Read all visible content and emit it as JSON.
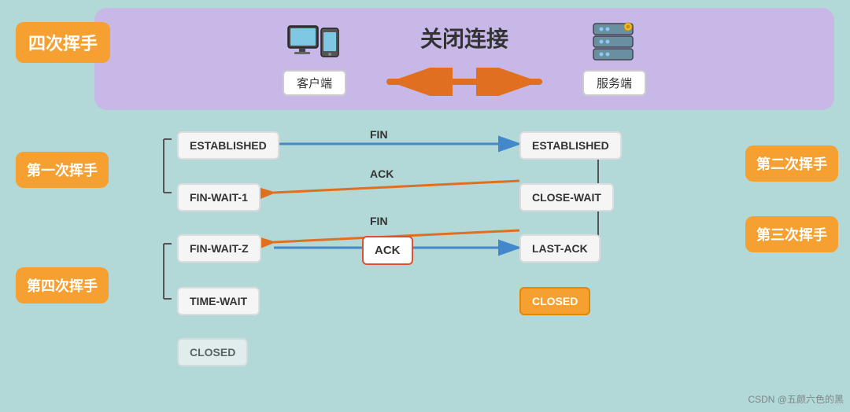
{
  "header": {
    "title": "关闭连接",
    "side_label": "四次挥手"
  },
  "client_label": "客户端",
  "server_label": "服务端",
  "steps": [
    {
      "label": "第一次挥手",
      "arrow": "FIN",
      "direction": "right",
      "from_state": "ESTABLISHED",
      "to_state": "ESTABLISHED"
    },
    {
      "label": "第二次挥手",
      "arrow": "ACK",
      "direction": "left",
      "from_state": "FIN-WAIT-1",
      "to_state": "CLOSE-WAIT"
    },
    {
      "label": "第三次挥手",
      "arrow": "FIN",
      "direction": "left",
      "from_state": "FIN-WAIT-2",
      "to_state": "LAST-ACK"
    },
    {
      "label": "第四次挥手",
      "arrow": "ACK",
      "direction": "right",
      "from_state": "TIME-WAIT",
      "to_state": "CLOSED"
    }
  ],
  "states": {
    "left": [
      "ESTABLISHED",
      "FIN-WAIT-1",
      "FIN-WAIT-Z",
      "TIME-WAIT",
      "CLOSED"
    ],
    "right": [
      "ESTABLISHED",
      "CLOSE-WAIT",
      "LAST-ACK",
      "CLOSED"
    ]
  },
  "watermark": "CSDN @五颜六色的黑"
}
